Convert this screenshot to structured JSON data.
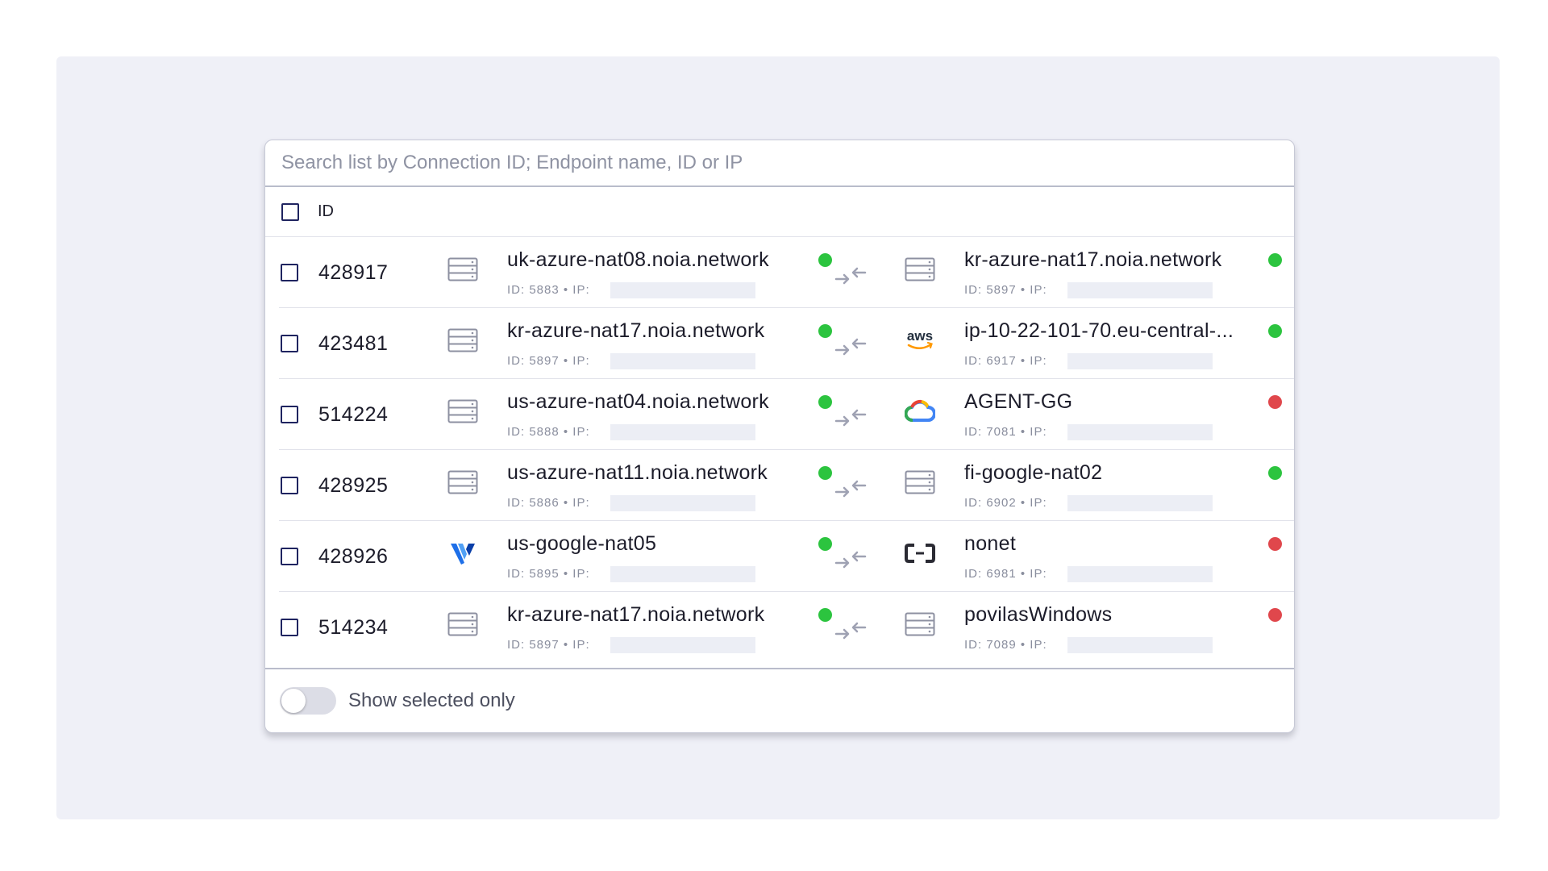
{
  "search": {
    "placeholder": "Search list by Connection ID; Endpoint name, ID or IP",
    "value": ""
  },
  "table": {
    "header_label": "ID"
  },
  "colors": {
    "online": "#2cc43f",
    "offline": "#e0474c",
    "accent": "#1f2460"
  },
  "rows": [
    {
      "id": "428917",
      "source": {
        "icon": "server-icon",
        "name": "uk-azure-nat08.noia.network",
        "meta": "ID: 5883 • IP:",
        "status": "online"
      },
      "target": {
        "icon": "server-icon",
        "name": "kr-azure-nat17.noia.network",
        "meta": "ID: 5897 • IP:",
        "status": "online"
      }
    },
    {
      "id": "423481",
      "source": {
        "icon": "server-icon",
        "name": "kr-azure-nat17.noia.network",
        "meta": "ID: 5897 • IP:",
        "status": "online"
      },
      "target": {
        "icon": "aws-icon",
        "icon_text": "aws",
        "name": "ip-10-22-101-70.eu-central-...",
        "meta": "ID: 6917 • IP:",
        "status": "online"
      }
    },
    {
      "id": "514224",
      "source": {
        "icon": "server-icon",
        "name": "us-azure-nat04.noia.network",
        "meta": "ID: 5888 • IP:",
        "status": "online"
      },
      "target": {
        "icon": "google-cloud-icon",
        "name": "AGENT-GG",
        "meta": "ID: 7081 • IP:",
        "status": "offline"
      }
    },
    {
      "id": "428925",
      "source": {
        "icon": "server-icon",
        "name": "us-azure-nat11.noia.network",
        "meta": "ID: 5886 • IP:",
        "status": "online"
      },
      "target": {
        "icon": "server-icon",
        "name": "fi-google-nat02",
        "meta": "ID: 6902 • IP:",
        "status": "online"
      }
    },
    {
      "id": "428926",
      "source": {
        "icon": "vultr-icon",
        "name": "us-google-nat05",
        "meta": "ID: 5895 • IP:",
        "status": "online"
      },
      "target": {
        "icon": "alibaba-cloud-icon",
        "name": "nonet",
        "meta": "ID: 6981 • IP:",
        "status": "offline"
      }
    },
    {
      "id": "514234",
      "source": {
        "icon": "server-icon",
        "name": "kr-azure-nat17.noia.network",
        "meta": "ID: 5897 • IP:",
        "status": "online"
      },
      "target": {
        "icon": "server-icon",
        "name": "povilasWindows",
        "meta": "ID: 7089 • IP:",
        "status": "offline"
      }
    }
  ],
  "footer": {
    "toggle_label": "Show selected only",
    "toggle_on": false
  }
}
